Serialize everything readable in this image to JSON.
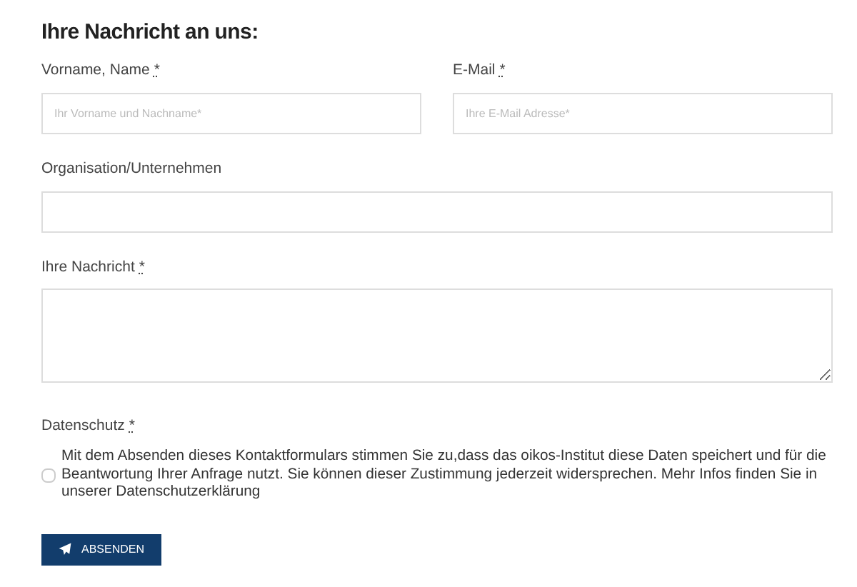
{
  "title": "Ihre Nachricht an uns:",
  "field_rows": [
    [
      {
        "kind": "input",
        "label": "Vorname, Name",
        "required_mark": "*",
        "placeholder": "Ihr Vorname und Nachname*"
      },
      {
        "kind": "input",
        "label": "E-Mail",
        "required_mark": "*",
        "placeholder": "Ihre E-Mail Adresse*"
      }
    ],
    [
      {
        "kind": "input",
        "label": "Organisation/Unternehmen"
      }
    ],
    [
      {
        "kind": "textarea",
        "label": "Ihre Nachricht",
        "required_mark": "*"
      }
    ]
  ],
  "privacy": {
    "label": "Datenschutz",
    "required_mark": "*",
    "checked": false,
    "text": "Mit dem Absenden dieses Kontaktformulars stimmen Sie zu,dass das oikos-Institut diese Daten speichert und für die Beantwortung Ihrer Anfrage nutzt. Sie können dieser Zustimmung jederzeit widersprechen. Mehr Infos finden Sie in unserer Datenschutzerklärung"
  },
  "submit": {
    "label": "ABSENDEN"
  }
}
